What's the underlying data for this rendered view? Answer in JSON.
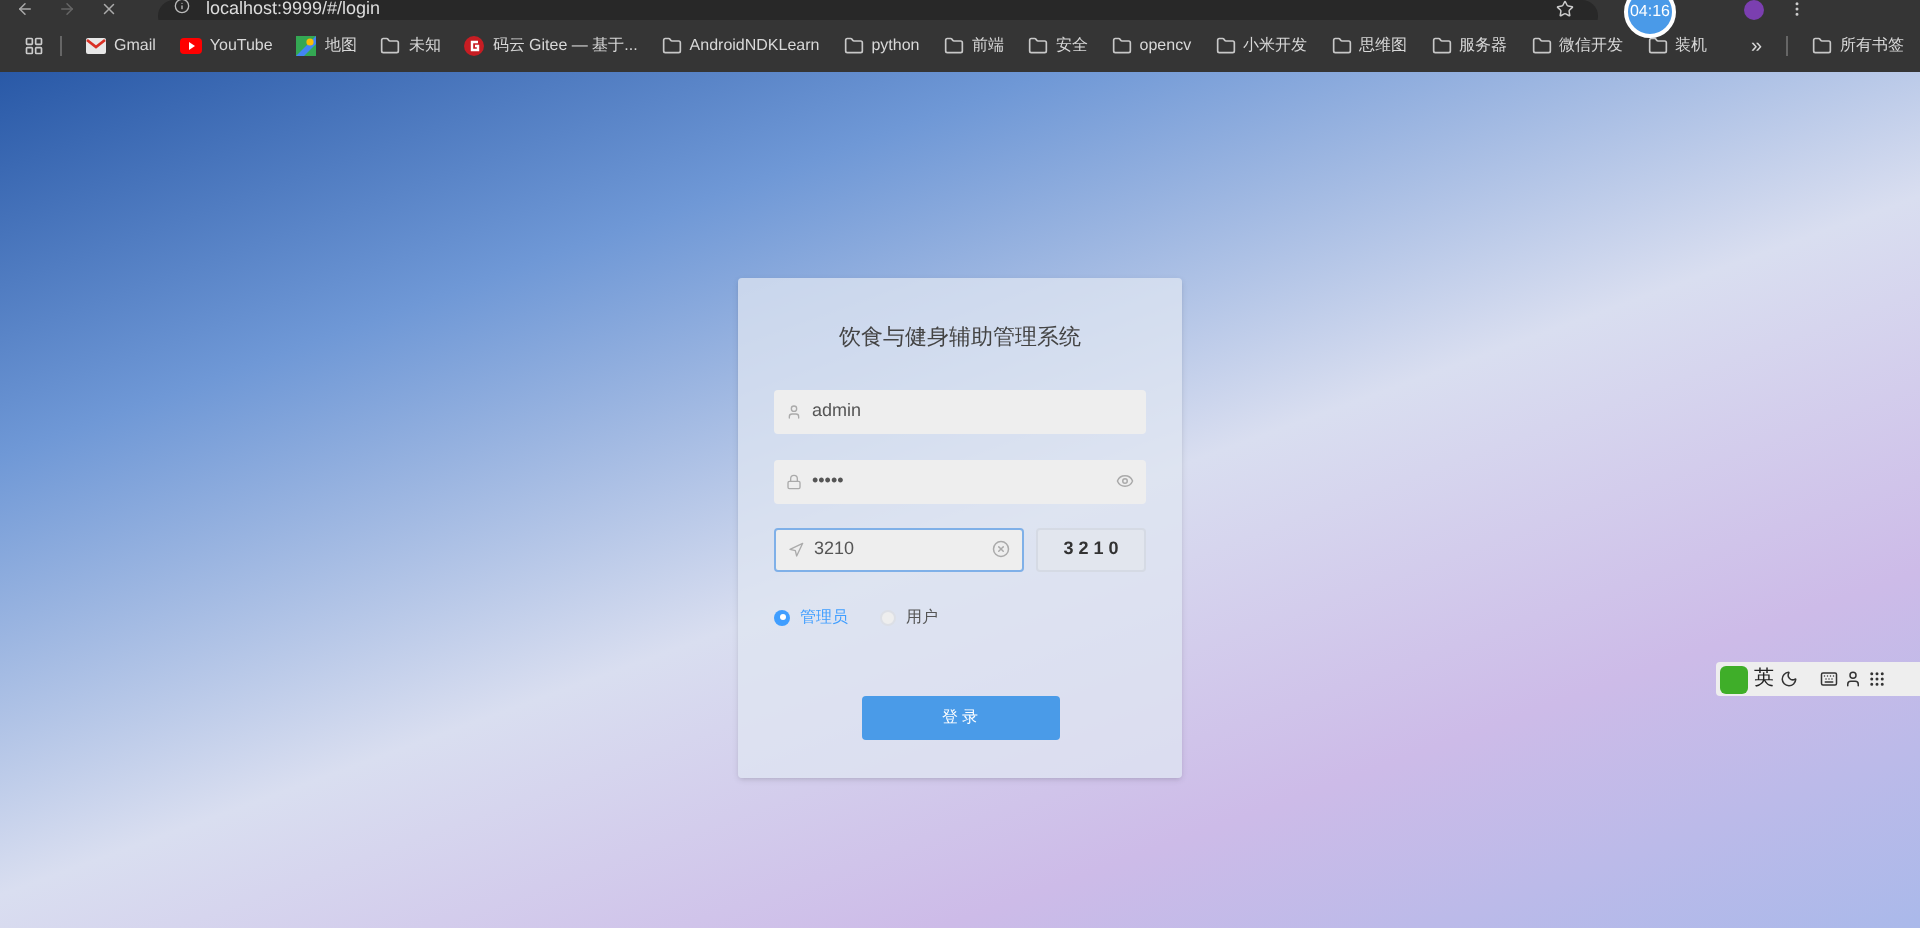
{
  "browser": {
    "address": "localhost:9999/#/login",
    "clock": "04:16"
  },
  "bookmarks": [
    {
      "kind": "gmail",
      "label": "Gmail"
    },
    {
      "kind": "youtube",
      "label": "YouTube"
    },
    {
      "kind": "maps",
      "label": "地图"
    },
    {
      "kind": "folder",
      "label": "未知"
    },
    {
      "kind": "gitee",
      "label": "码云 Gitee — 基于..."
    },
    {
      "kind": "folder",
      "label": "AndroidNDKLearn"
    },
    {
      "kind": "folder",
      "label": "python"
    },
    {
      "kind": "folder",
      "label": "前端"
    },
    {
      "kind": "folder",
      "label": "安全"
    },
    {
      "kind": "folder",
      "label": "opencv"
    },
    {
      "kind": "folder",
      "label": "小米开发"
    },
    {
      "kind": "folder",
      "label": "思维图"
    },
    {
      "kind": "folder",
      "label": "服务器"
    },
    {
      "kind": "folder",
      "label": "微信开发"
    },
    {
      "kind": "folder",
      "label": "装机"
    }
  ],
  "bookmarks_more": "»",
  "all_bookmarks": "所有书签",
  "login": {
    "title": "饮食与健身辅助管理系统",
    "username": "admin",
    "password": "•••••",
    "captcha": "3210",
    "captcha_code": "3 2 1 0",
    "roles": [
      {
        "label": "管理员",
        "selected": true
      },
      {
        "label": "用户",
        "selected": false
      }
    ],
    "submit": "登 录"
  },
  "ime": {
    "mode": "英"
  }
}
